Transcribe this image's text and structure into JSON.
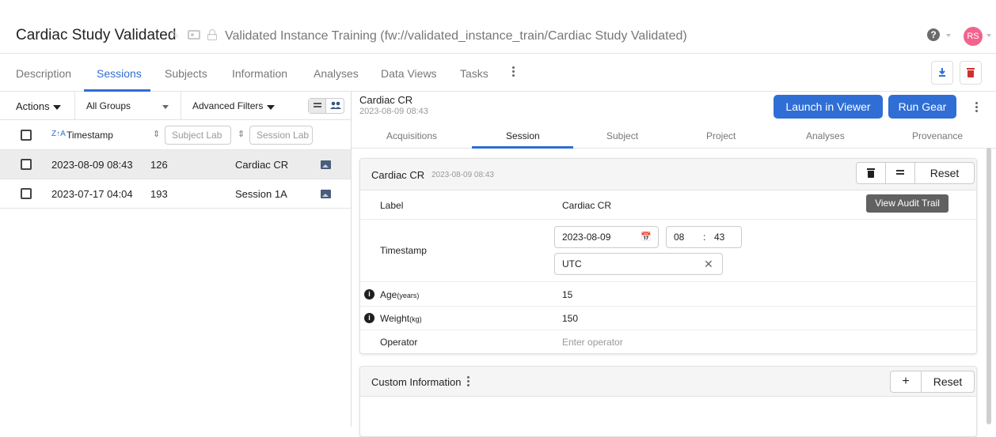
{
  "header": {
    "title": "Cardiac Study Validated",
    "project_path": "Validated Instance Training (fw://validated_instance_train/Cardiac Study Validated)",
    "avatar_initials": "RS",
    "help_glyph": "?"
  },
  "tabs": [
    "Description",
    "Sessions",
    "Subjects",
    "Information",
    "Analyses",
    "Data Views",
    "Tasks"
  ],
  "left": {
    "actions_label": "Actions",
    "group_select": "All Groups",
    "advanced_filters": "Advanced Filters",
    "sort_glyph": "Z↑A",
    "col_timestamp": "Timestamp",
    "col_subject_placeholder": "Subject Lab",
    "col_session_placeholder": "Session Lab",
    "rows": [
      {
        "timestamp": "2023-08-09 08:43",
        "subject": "126",
        "session": "Cardiac CR"
      },
      {
        "timestamp": "2023-07-17 04:04",
        "subject": "193",
        "session": "Session 1A"
      }
    ]
  },
  "right": {
    "session_title": "Cardiac CR",
    "session_date": "2023-08-09 08:43",
    "launch_label": "Launch in Viewer",
    "run_gear_label": "Run Gear",
    "tabs": [
      "Acquisitions",
      "Session",
      "Subject",
      "Project",
      "Analyses",
      "Provenance"
    ],
    "card": {
      "title": "Cardiac CR",
      "title_date": "2023-08-09 08:43",
      "reset_label": "Reset",
      "tooltip": "View Audit Trail",
      "fields": {
        "label_name": "Label",
        "label_value": "Cardiac CR",
        "timestamp_name": "Timestamp",
        "date_value": "2023-08-09",
        "hour_value": "08",
        "time_sep": ":",
        "minute_value": "43",
        "timezone_value": "UTC",
        "age_name": "Age",
        "age_unit": "(years)",
        "age_value": "15",
        "weight_name": "Weight",
        "weight_unit": "(kg)",
        "weight_value": "150",
        "operator_name": "Operator",
        "operator_placeholder": "Enter operator"
      }
    },
    "custom": {
      "title": "Custom Information",
      "add_glyph": "+",
      "reset_label": "Reset"
    }
  },
  "colors": {
    "accent": "#2f6ed5",
    "delete_red": "#d32f2f",
    "avatar": "#f1648c"
  }
}
